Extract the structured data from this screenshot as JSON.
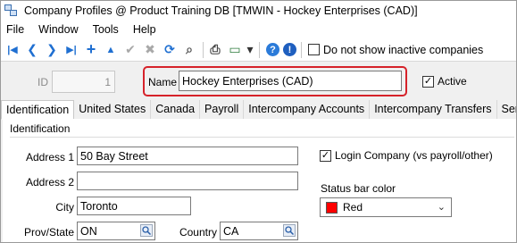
{
  "window": {
    "title": "Company Profiles @ Product Training DB [TMWIN - Hockey Enterprises (CAD)]"
  },
  "menu": [
    "File",
    "Window",
    "Tools",
    "Help"
  ],
  "toolbar": {
    "buttons": [
      {
        "name": "first-record",
        "glyph": "|◀"
      },
      {
        "name": "previous-record",
        "glyph": "❮"
      },
      {
        "name": "next-record",
        "glyph": "❯"
      },
      {
        "name": "last-record",
        "glyph": "▶|"
      },
      {
        "name": "add-record",
        "glyph": "+"
      },
      {
        "name": "move-up",
        "glyph": "▲"
      },
      {
        "name": "post-check",
        "glyph": "✔"
      },
      {
        "name": "cancel",
        "glyph": "✖"
      },
      {
        "name": "refresh",
        "glyph": "⟳"
      },
      {
        "name": "search",
        "glyph": "⌕"
      },
      {
        "name": "print",
        "glyph": "⎙"
      },
      {
        "name": "monitor",
        "glyph": "▭"
      },
      {
        "name": "dropdown",
        "glyph": "▾"
      },
      {
        "name": "help",
        "glyph": "?"
      },
      {
        "name": "info",
        "glyph": "!"
      }
    ],
    "inactive_label": "Do not show inactive companies",
    "inactive_checked": false
  },
  "header": {
    "id_label": "ID",
    "id_value": "1",
    "name_label": "Name",
    "name_value": "Hockey Enterprises (CAD)",
    "active_label": "Active",
    "active_checked": true,
    "highlight_color": "#d6222a"
  },
  "tabs": [
    {
      "label": "Identification",
      "active": true
    },
    {
      "label": "United States",
      "active": false
    },
    {
      "label": "Canada",
      "active": false
    },
    {
      "label": "Payroll",
      "active": false
    },
    {
      "label": "Intercompany Accounts",
      "active": false
    },
    {
      "label": "Intercompany Transfers",
      "active": false
    },
    {
      "label": "Series",
      "active": false
    }
  ],
  "identification": {
    "group_title": "Identification",
    "address1_label": "Address 1",
    "address1_value": "50 Bay Street",
    "address2_label": "Address 2",
    "address2_value": "",
    "city_label": "City",
    "city_value": "Toronto",
    "prov_label": "Prov/State",
    "prov_value": "ON",
    "country_label": "Country",
    "country_value": "CA",
    "login_label": "Login Company (vs payroll/other)",
    "login_checked": true,
    "status_color_label": "Status bar color",
    "status_color_value": "Red",
    "status_color_hex": "#ff0000"
  }
}
